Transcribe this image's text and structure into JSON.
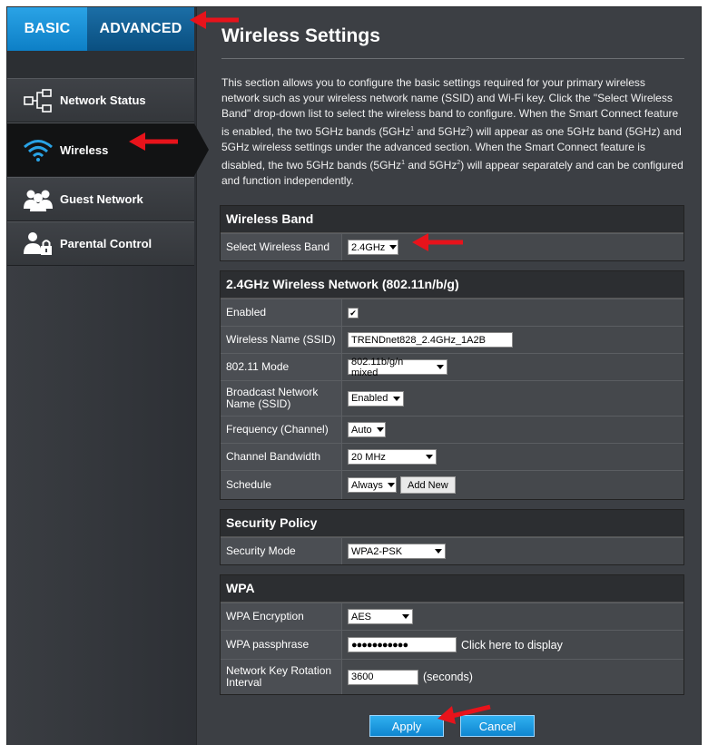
{
  "tabs": {
    "basic": "BASIC",
    "advanced": "ADVANCED"
  },
  "sidebar": {
    "items": [
      {
        "label": "Network Status",
        "icon": "network-status-icon"
      },
      {
        "label": "Wireless",
        "icon": "wifi-icon",
        "active": true
      },
      {
        "label": "Guest Network",
        "icon": "guest-network-icon"
      },
      {
        "label": "Parental Control",
        "icon": "parental-control-icon"
      }
    ]
  },
  "page": {
    "title": "Wireless Settings",
    "intro_1": "This section allows you to configure the basic settings required for your primary wireless network such as your wireless network name (SSID) and Wi-Fi key. Click the \"Select Wireless Band\" drop-down list to select the wireless band to configure. When the Smart Connect feature is enabled, the two 5GHz bands (5GHz",
    "intro_sup1": "1",
    "intro_2": " and 5GHz",
    "intro_sup2": "2",
    "intro_3": ") will appear as one 5GHz band (5GHz) and 5GHz wireless settings under the advanced section. When the Smart Connect feature is disabled, the two 5GHz bands (5GHz",
    "intro_sup3": "1",
    "intro_4": " and 5GHz",
    "intro_sup4": "2",
    "intro_5": ") will appear separately and can be configured and function independently."
  },
  "band": {
    "header": "Wireless Band",
    "select_label": "Select Wireless Band",
    "select_value": "2.4GHz"
  },
  "network": {
    "header": "2.4GHz Wireless Network (802.11n/b/g)",
    "enabled_label": "Enabled",
    "enabled_checked": "✔",
    "ssid_label": "Wireless Name (SSID)",
    "ssid_value": "TRENDnet828_2.4GHz_1A2B",
    "mode_label": "802.11 Mode",
    "mode_value": "802.11b/g/n mixed",
    "broadcast_label": "Broadcast Network Name (SSID)",
    "broadcast_value": "Enabled",
    "freq_label": "Frequency (Channel)",
    "freq_value": "Auto",
    "bw_label": "Channel Bandwidth",
    "bw_value": "20 MHz",
    "schedule_label": "Schedule",
    "schedule_value": "Always",
    "add_new": "Add New"
  },
  "security": {
    "header": "Security Policy",
    "mode_label": "Security Mode",
    "mode_value": "WPA2-PSK"
  },
  "wpa": {
    "header": "WPA",
    "enc_label": "WPA Encryption",
    "enc_value": "AES",
    "pass_label": "WPA passphrase",
    "pass_value": "●●●●●●●●●●●",
    "pass_display": "Click here to display",
    "rotation_label": "Network Key Rotation Interval",
    "rotation_value": "3600",
    "rotation_unit": "(seconds)"
  },
  "actions": {
    "apply": "Apply",
    "cancel": "Cancel"
  },
  "colors": {
    "accent": "#1a95db",
    "arrow": "#e8131b"
  }
}
